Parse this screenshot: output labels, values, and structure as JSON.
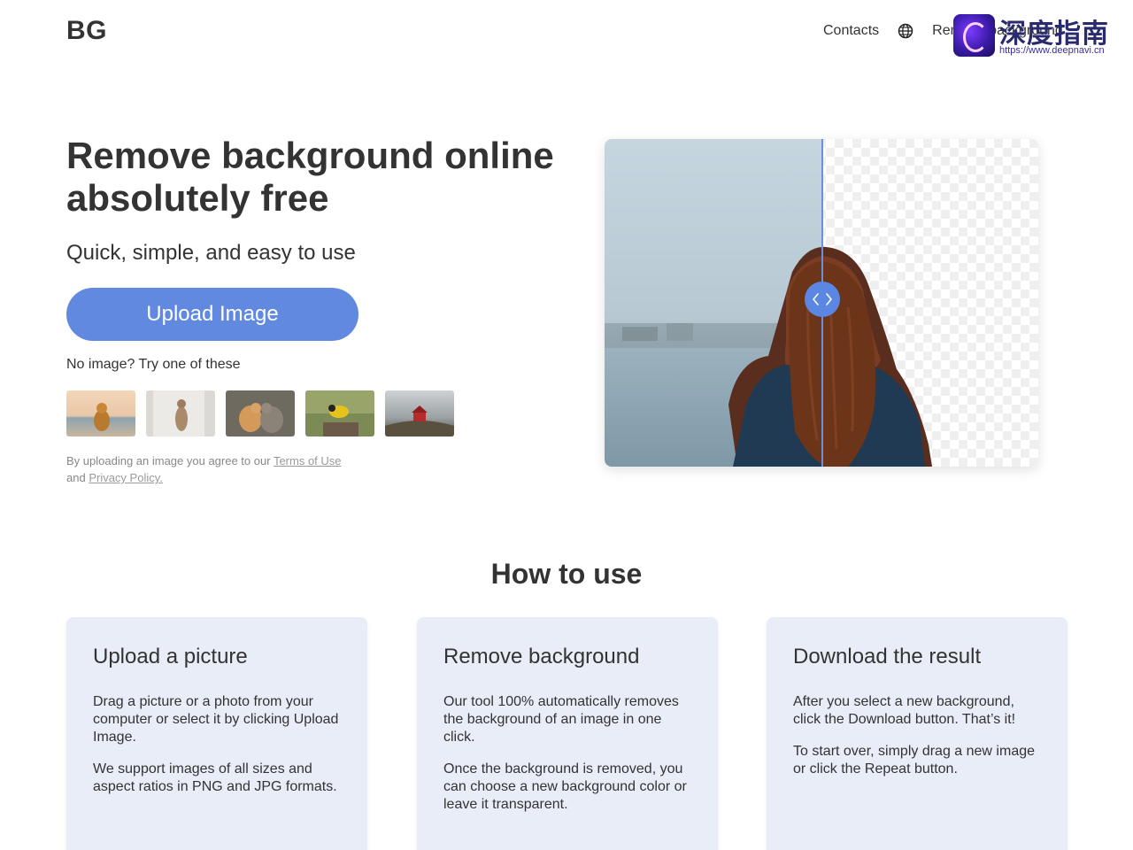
{
  "header": {
    "logo": "BG",
    "nav": {
      "contacts": "Contacts",
      "language_icon": "globe-icon",
      "remove_background": "Remove background"
    }
  },
  "watermark": {
    "title": "深度指南",
    "url": "https://www.deepnavi.cn"
  },
  "hero": {
    "title": "Remove background online absolutely free",
    "subtitle": "Quick, simple, and easy to use",
    "upload_button": "Upload Image",
    "try_text": "No image? Try one of these",
    "samples": [
      "dog on beach",
      "cat standing",
      "two cats",
      "yellow bird",
      "red house"
    ],
    "terms_prefix": "By uploading an image you agree to our ",
    "terms_link": "Terms of Use",
    "terms_middle": "and ",
    "privacy_link": "Privacy Policy."
  },
  "comparison": {
    "handle_icon": "left-right-arrows-icon"
  },
  "how_to_use": {
    "title": "How to use",
    "cards": [
      {
        "title": "Upload a picture",
        "paragraphs": [
          "Drag a picture or a photo from your computer or select it by clicking Upload Image.",
          "We support images of all sizes and aspect ratios in PNG and JPG formats."
        ]
      },
      {
        "title": "Remove background",
        "paragraphs": [
          "Our tool 100% automatically removes the background of an image in one click.",
          "Once the background is removed, you can choose a new background color or leave it transparent."
        ]
      },
      {
        "title": "Download the result",
        "paragraphs": [
          "After you select a new background, click the Download button. That’s it!",
          "To start over, simply drag a new image or click the Repeat button."
        ]
      }
    ]
  },
  "colors": {
    "accent": "#6189e0",
    "card_bg": "#e8edf8",
    "text": "#333333"
  }
}
